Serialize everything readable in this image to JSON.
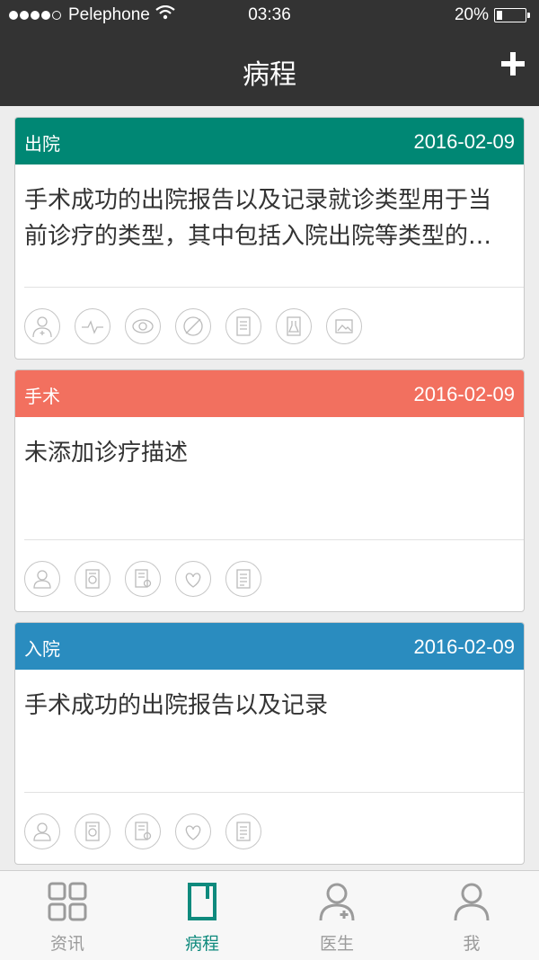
{
  "status_bar": {
    "carrier": "Pelephone",
    "time": "03:36",
    "battery": "20%",
    "battery_level": 0.2
  },
  "nav": {
    "title": "病程",
    "add_icon": "plus-icon"
  },
  "records": [
    {
      "type": "出院",
      "date": "2016-02-09",
      "color": "#008774",
      "description": "手术成功的出院报告以及记录就诊类型用于当前诊疗的类型，其中包括入院出院等类型的记录内容",
      "icons": [
        "doctor-icon",
        "pulse-icon",
        "eye-icon",
        "no-icon",
        "report-icon",
        "lab-flask-icon",
        "image-icon"
      ]
    },
    {
      "type": "手术",
      "date": "2016-02-09",
      "color": "#f2705f",
      "description": "未添加诊疗描述",
      "icons": [
        "person-icon",
        "scan-doc-icon",
        "search-doc-icon",
        "heart-diagram-icon",
        "list-doc-icon"
      ]
    },
    {
      "type": "入院",
      "date": "2016-02-09",
      "color": "#2a8cbf",
      "description": "手术成功的出院报告以及记录",
      "icons": [
        "person-icon",
        "scan-doc-icon",
        "search-doc-icon",
        "heart-diagram-icon",
        "list-doc-icon"
      ]
    }
  ],
  "tabs": [
    {
      "label": "资讯",
      "icon": "grid-icon"
    },
    {
      "label": "病程",
      "icon": "notebook-icon",
      "active": true
    },
    {
      "label": "医生",
      "icon": "doctor-icon"
    },
    {
      "label": "我",
      "icon": "user-icon"
    }
  ],
  "colors": {
    "bar_bg": "#333333",
    "active": "#0f8a7d",
    "inactive": "#9b9b9b"
  }
}
